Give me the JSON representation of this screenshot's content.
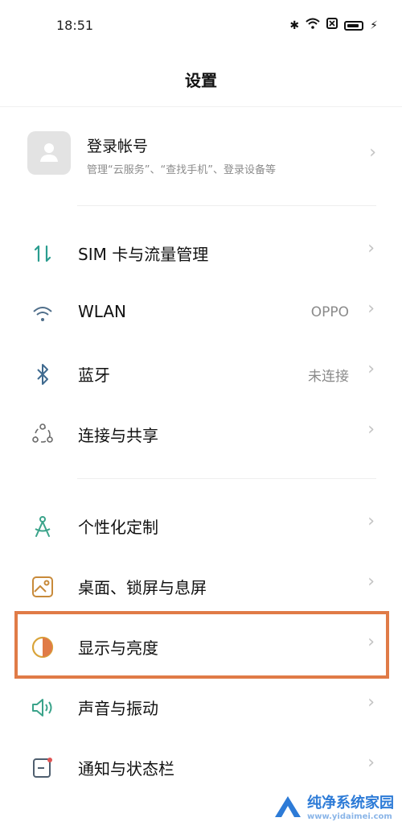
{
  "status_bar": {
    "time": "18:51",
    "icons": [
      "bluetooth-icon",
      "wifi-icon",
      "sim-off-icon",
      "battery-charging-icon"
    ]
  },
  "header": {
    "title": "设置"
  },
  "account": {
    "title": "登录帐号",
    "subtitle": "管理“云服务”、“查找手机”、登录设备等"
  },
  "chevron": "›",
  "settings": [
    {
      "label": "SIM 卡与流量管理",
      "value": "",
      "icon": "sim-data-icon"
    },
    {
      "label": "WLAN",
      "value": "OPPO",
      "icon": "wifi-icon"
    },
    {
      "label": "蓝牙",
      "value": "未连接",
      "icon": "bluetooth-icon"
    },
    {
      "label": "连接与共享",
      "value": "",
      "icon": "connection-share-icon"
    },
    {
      "label": "个性化定制",
      "value": "",
      "icon": "personalization-icon"
    },
    {
      "label": "桌面、锁屏与息屏",
      "value": "",
      "icon": "wallpaper-icon"
    },
    {
      "label": "显示与亮度",
      "value": "",
      "icon": "display-brightness-icon"
    },
    {
      "label": "声音与振动",
      "value": "",
      "icon": "sound-icon"
    },
    {
      "label": "通知与状态栏",
      "value": "",
      "icon": "notification-icon"
    }
  ],
  "watermark": {
    "main": "纯净系统家园",
    "sub": "www.yidaimei.com"
  },
  "colors": {
    "highlight": "#e07b47",
    "icon_teal": "#2a9d8f",
    "chevron": "#c3c3c3"
  }
}
